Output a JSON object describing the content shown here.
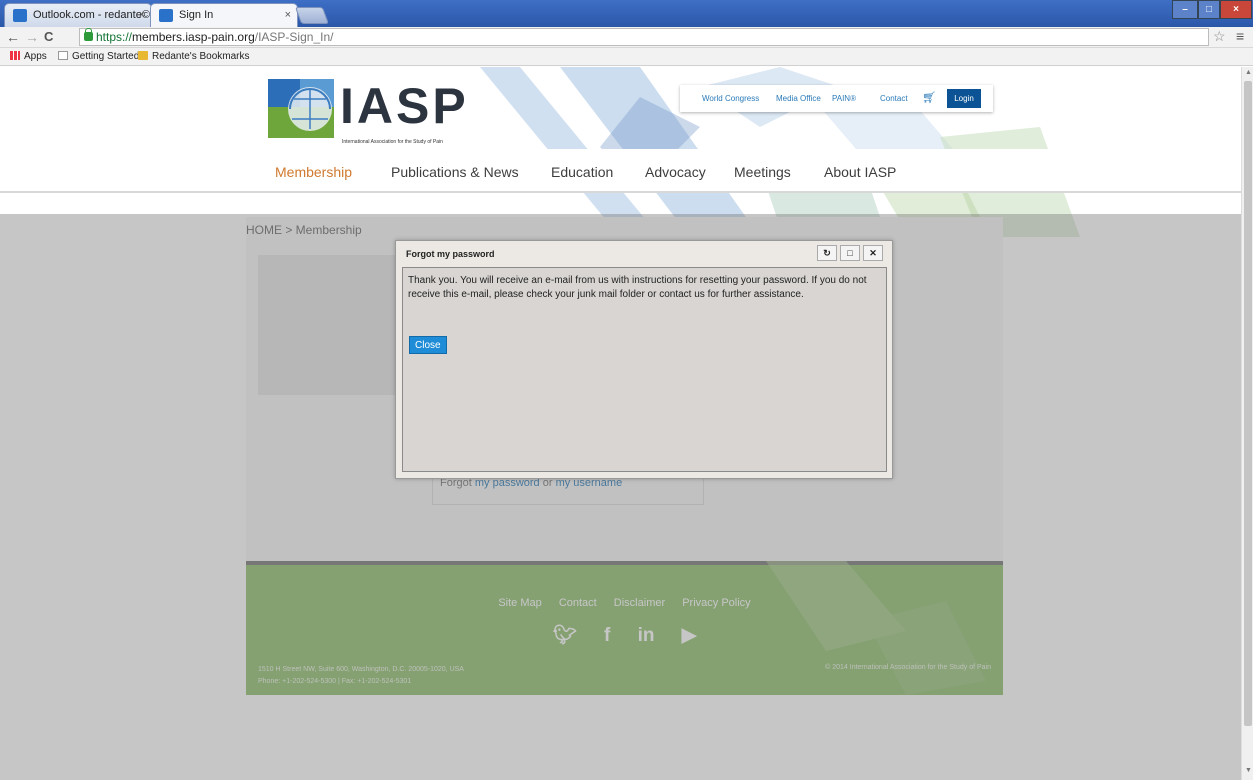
{
  "browser": {
    "tabs": [
      {
        "title": "Outlook.com - redante©"
      },
      {
        "title": "Sign In"
      }
    ],
    "url_https": "https://",
    "url_host": "members.iasp-pain.org",
    "url_path": "/IASP-Sign_In/",
    "bookmarks": [
      "Apps",
      "Getting Started",
      "Redante's Bookmarks"
    ]
  },
  "site": {
    "logo_text": "IASP",
    "logo_subtitle": "International Association for the Study of Pain",
    "util_links": [
      "World Congress",
      "Media Office",
      "PAIN®",
      "Contact"
    ],
    "login_label": "Login",
    "nav": [
      "Membership",
      "Publications & News",
      "Education",
      "Advocacy",
      "Meetings",
      "About IASP"
    ],
    "breadcrumb": "HOME > Membership",
    "forgot_prefix": "Forgot",
    "forgot_password": "my password",
    "forgot_or": "or",
    "forgot_username": "my username"
  },
  "footer": {
    "links": [
      "Site Map",
      "Contact",
      "Disclaimer",
      "Privacy Policy"
    ],
    "address_line1": "1510 H Street NW, Suite 600, Washington, D.C. 20005-1020, USA",
    "address_line2": "Phone: +1-202-524-5300 | Fax: +1-202-524-5301",
    "copyright": "© 2014 International Association for the Study of Pain"
  },
  "dialog": {
    "title": "Forgot my password",
    "message": "Thank you. You will receive an e-mail from us with instructions for resetting your password. If you do not receive this e-mail, please check your junk mail folder or contact us for further assistance.",
    "close_label": "Close"
  },
  "colors": {
    "accent": "#d0792e",
    "brand_blue": "#0b5394",
    "footer_green": "#8fbf6f",
    "dialog_button": "#1e8cd6"
  }
}
